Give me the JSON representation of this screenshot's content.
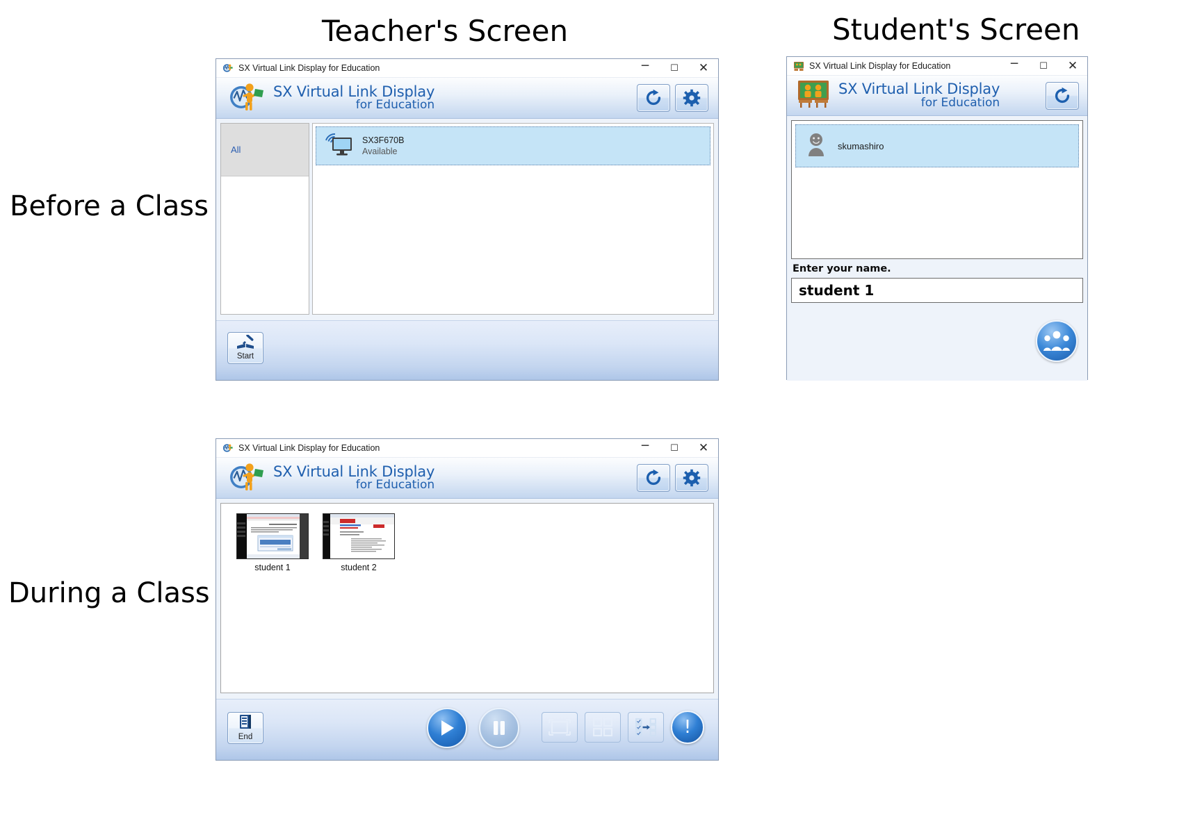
{
  "headings": {
    "teacher": "Teacher's Screen",
    "student": "Student's Screen"
  },
  "row_labels": {
    "before": "Before a Class",
    "during": "During a Class"
  },
  "app": {
    "window_title": "SX Virtual Link Display for Education",
    "brand_line1": "SX Virtual Link Display",
    "brand_line2": "for Education",
    "accent_blue": "#1f5fae",
    "selection_blue": "#c5e4f7"
  },
  "window_controls": {
    "minimize": "─",
    "maximize": "☐",
    "close": "✕"
  },
  "teacher_before": {
    "group_all_label": "All",
    "device": {
      "name": "SX3F670B",
      "status": "Available"
    },
    "start_button_label": "Start"
  },
  "teacher_during": {
    "thumbnails": [
      {
        "label": "student 1"
      },
      {
        "label": "student 2"
      }
    ],
    "end_button_label": "End",
    "toolbar_icons": [
      "play-icon",
      "pause-icon",
      "fullscreen-layout-icon",
      "grid-layout-icon",
      "assign-layout-icon",
      "alert-icon"
    ],
    "alert_glyph": "!"
  },
  "student_before": {
    "teacher_entry": "skumashiro",
    "enter_name_label": "Enter your name.",
    "name_value": "student 1"
  }
}
